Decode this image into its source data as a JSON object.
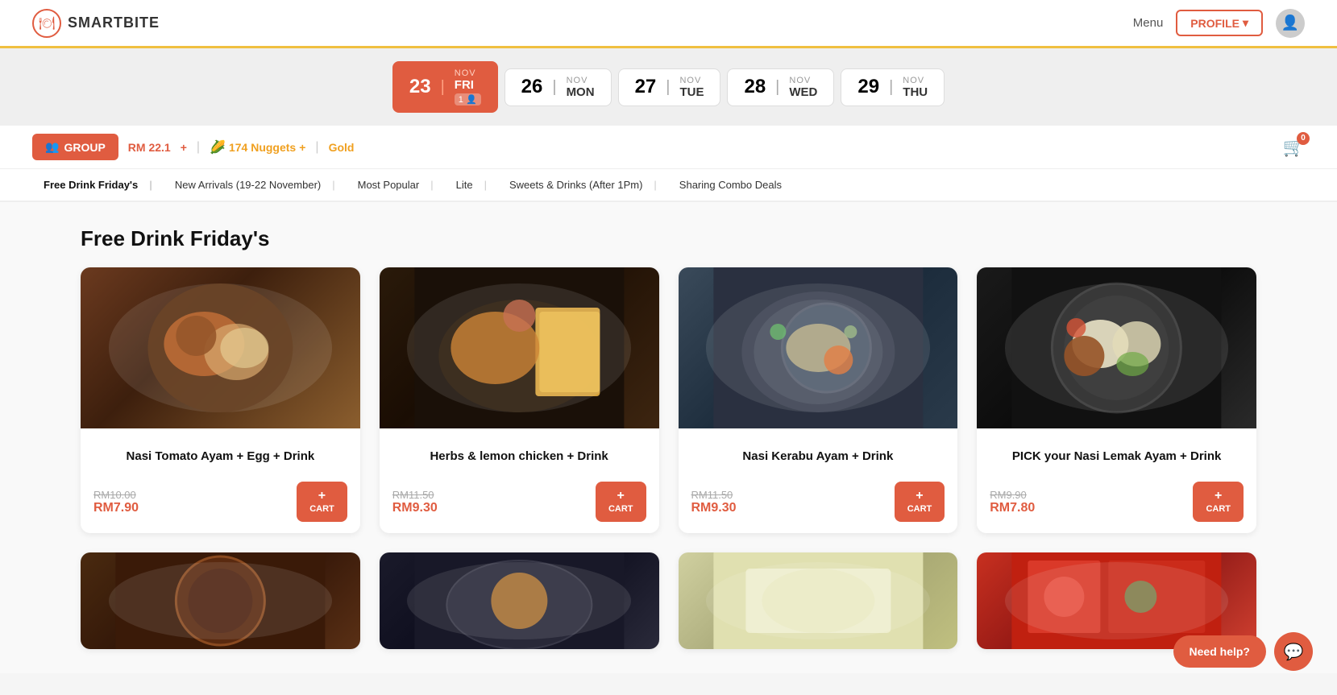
{
  "header": {
    "logo_text": "SMARTBITE",
    "logo_icon": "🍽",
    "menu_label": "Menu",
    "profile_label": "PROFILE",
    "profile_chevron": "▾",
    "avatar_icon": "👤"
  },
  "date_bar": {
    "dates": [
      {
        "num": "23",
        "month": "NOV",
        "day": "FRI",
        "active": true,
        "badge": "1 👤"
      },
      {
        "num": "26",
        "month": "NOV",
        "day": "MON",
        "active": false
      },
      {
        "num": "27",
        "month": "NOV",
        "day": "TUE",
        "active": false
      },
      {
        "num": "28",
        "month": "NOV",
        "day": "WED",
        "active": false
      },
      {
        "num": "29",
        "month": "NOV",
        "day": "THU",
        "active": false
      }
    ]
  },
  "info_bar": {
    "group_label": "GROUP",
    "rm_amount": "RM 22.1",
    "rm_plus": "+",
    "nuggets_icon": "🌽",
    "nuggets_count": "174 Nuggets",
    "nuggets_plus": "+",
    "gold_label": "Gold",
    "cart_count": "0"
  },
  "nav_tabs": {
    "items": [
      {
        "label": "Free Drink Friday's",
        "active": true
      },
      {
        "label": "New Arrivals (19-22 November)",
        "active": false
      },
      {
        "label": "Most Popular",
        "active": false
      },
      {
        "label": "Lite",
        "active": false
      },
      {
        "label": "Sweets & Drinks (After 1Pm)",
        "active": false
      },
      {
        "label": "Sharing Combo Deals",
        "active": false
      }
    ]
  },
  "main": {
    "section_title": "Free Drink Friday's",
    "products_row1": [
      {
        "name": "Nasi Tomato Ayam + Egg + Drink",
        "original_price": "RM10.00",
        "sale_price": "RM7.90",
        "cart_label": "CART",
        "img_class": "food-img-1"
      },
      {
        "name": "Herbs & lemon chicken + Drink",
        "original_price": "RM11.50",
        "sale_price": "RM9.30",
        "cart_label": "CART",
        "img_class": "food-img-2"
      },
      {
        "name": "Nasi Kerabu Ayam + Drink",
        "original_price": "RM11.50",
        "sale_price": "RM9.30",
        "cart_label": "CART",
        "img_class": "food-img-3"
      },
      {
        "name": "PICK your Nasi Lemak Ayam + Drink",
        "original_price": "RM9.90",
        "sale_price": "RM7.80",
        "cart_label": "CART",
        "img_class": "food-img-4"
      }
    ],
    "products_row2": [
      {
        "img_class": "food-img-5"
      },
      {
        "img_class": "food-img-6"
      },
      {
        "img_class": "food-img-7"
      },
      {
        "img_class": "food-img-8"
      }
    ]
  },
  "help": {
    "need_help_label": "Need help?",
    "chat_icon": "💬"
  }
}
